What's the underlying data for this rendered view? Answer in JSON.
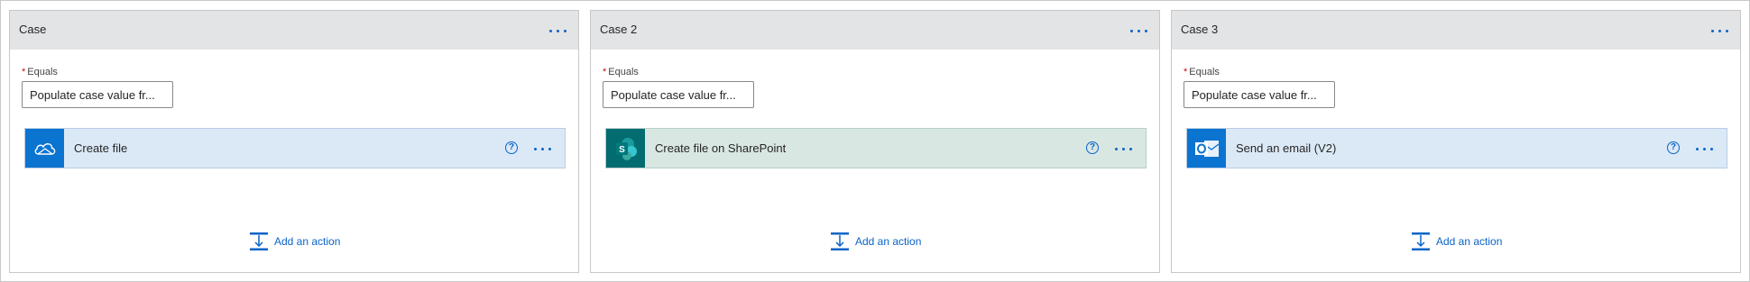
{
  "cases": [
    {
      "title": "Case",
      "equals_label": "Equals",
      "equals_value": "Populate case value fr...",
      "action": {
        "title": "Create file",
        "icon": "onedrive-cloud-icon",
        "icon_bg": "#0b74d1",
        "card_bg": "#dbe9f6"
      },
      "add_action_label": "Add an action"
    },
    {
      "title": "Case 2",
      "equals_label": "Equals",
      "equals_value": "Populate case value fr...",
      "action": {
        "title": "Create file on SharePoint",
        "icon": "sharepoint-icon",
        "icon_bg": "#036c70",
        "card_bg": "#d9e7e3"
      },
      "add_action_label": "Add an action"
    },
    {
      "title": "Case 3",
      "equals_label": "Equals",
      "equals_value": "Populate case value fr...",
      "action": {
        "title": "Send an email (V2)",
        "icon": "outlook-icon",
        "icon_bg": "#0b74d1",
        "card_bg": "#dbe9f6"
      },
      "add_action_label": "Add an action"
    }
  ],
  "colors": {
    "accent": "#0b63c7",
    "header_bg": "#e3e4e6",
    "required": "#c50f1f"
  }
}
